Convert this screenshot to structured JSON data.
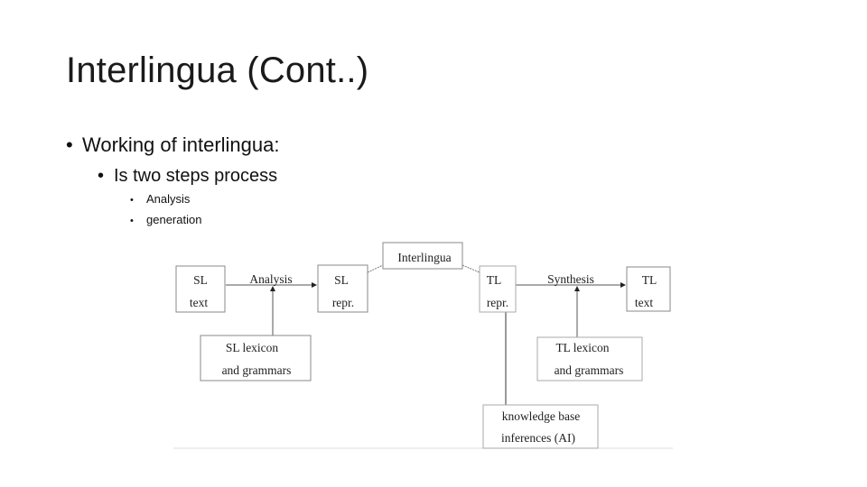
{
  "slide": {
    "title": "Interlingua (Cont..)",
    "bullets": {
      "level1": "Working of interlingua:",
      "level2": "Is two steps process",
      "level3": [
        "Analysis",
        "generation"
      ]
    }
  },
  "diagram": {
    "boxes": {
      "sl_text": [
        "SL",
        "text"
      ],
      "sl_repr": [
        "SL",
        "repr."
      ],
      "interlingua": "Interlingua",
      "tl_repr": [
        "TL",
        "repr."
      ],
      "tl_text": [
        "TL",
        "text"
      ],
      "sl_lexicon": [
        "SL lexicon",
        "and grammars"
      ],
      "tl_lexicon": [
        "TL lexicon",
        "and grammars"
      ],
      "knowledge": [
        "knowledge base",
        "inferences (AI)"
      ]
    },
    "edge_labels": {
      "analysis": "Analysis",
      "synthesis": "Synthesis"
    }
  }
}
